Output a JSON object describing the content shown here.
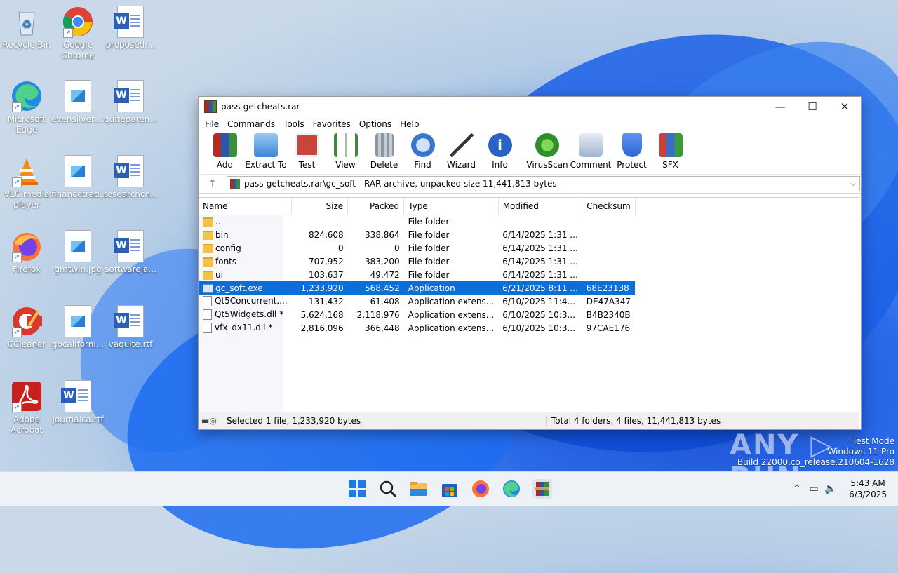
{
  "desktop": {
    "icons": [
      {
        "label": "Recycle Bin"
      },
      {
        "label": "Google Chrome"
      },
      {
        "label": "proposedr..."
      },
      {
        "label": "Microsoft Edge"
      },
      {
        "label": "evensilver...."
      },
      {
        "label": "quiteparen..."
      },
      {
        "label": "VLC media player"
      },
      {
        "label": "financetrad..."
      },
      {
        "label": "researchch..."
      },
      {
        "label": "Firefox"
      },
      {
        "label": "gmtwin.jpg"
      },
      {
        "label": "softwareja..."
      },
      {
        "label": "CCleaner"
      },
      {
        "label": "gocaliforni..."
      },
      {
        "label": "vaquite.rtf"
      },
      {
        "label": "Adobe Acrobat"
      },
      {
        "label": "journalca.rtf"
      }
    ]
  },
  "window": {
    "title": "pass-getcheats.rar",
    "controls": {
      "minimize": "—",
      "maximize": "☐",
      "close": "✕"
    },
    "menu": [
      "File",
      "Commands",
      "Tools",
      "Favorites",
      "Options",
      "Help"
    ],
    "toolbar": [
      {
        "label": "Add",
        "color": "#b62a21"
      },
      {
        "label": "Extract To",
        "color": "#3c86d8"
      },
      {
        "label": "Test",
        "color": "#c8453c"
      },
      {
        "label": "View",
        "color": "#3c8a3c"
      },
      {
        "label": "Delete",
        "color": "#8b96a3"
      },
      {
        "label": "Find",
        "color": "#3977cf"
      },
      {
        "label": "Wizard",
        "color": "#6aa3d9"
      },
      {
        "label": "Info",
        "color": "#2a63c4"
      },
      {
        "label": "VirusScan",
        "color": "#3aa832"
      },
      {
        "label": "Comment",
        "color": "#6f8fb5"
      },
      {
        "label": "Protect",
        "color": "#2e67d6"
      },
      {
        "label": "SFX",
        "color": "#c8413a"
      }
    ],
    "address": "pass-getcheats.rar\\gc_soft - RAR archive, unpacked size 11,441,813 bytes",
    "columns": {
      "name": "Name",
      "size": "Size",
      "packed": "Packed",
      "type": "Type",
      "modified": "Modified",
      "checksum": "Checksum"
    },
    "rows": [
      {
        "icon": "folder",
        "name": "..",
        "size": "",
        "packed": "",
        "type": "File folder",
        "modified": "",
        "checksum": ""
      },
      {
        "icon": "folder",
        "name": "bin",
        "size": "824,608",
        "packed": "338,864",
        "type": "File folder",
        "modified": "6/14/2025 1:31 ...",
        "checksum": ""
      },
      {
        "icon": "folder",
        "name": "config",
        "size": "0",
        "packed": "0",
        "type": "File folder",
        "modified": "6/14/2025 1:31 ...",
        "checksum": ""
      },
      {
        "icon": "folder",
        "name": "fonts",
        "size": "707,952",
        "packed": "383,200",
        "type": "File folder",
        "modified": "6/14/2025 1:31 ...",
        "checksum": ""
      },
      {
        "icon": "folder",
        "name": "ui",
        "size": "103,637",
        "packed": "49,472",
        "type": "File folder",
        "modified": "6/14/2025 1:31 ...",
        "checksum": ""
      },
      {
        "icon": "exe",
        "name": "gc_soft.exe",
        "size": "1,233,920",
        "packed": "568,452",
        "type": "Application",
        "modified": "6/21/2025 8:11 ...",
        "checksum": "68E23138",
        "selected": true
      },
      {
        "icon": "file",
        "name": "Qt5Concurrent....",
        "size": "131,432",
        "packed": "61,408",
        "type": "Application extens...",
        "modified": "6/10/2025 11:4...",
        "checksum": "DE47A347"
      },
      {
        "icon": "file",
        "name": "Qt5Widgets.dll *",
        "size": "5,624,168",
        "packed": "2,118,976",
        "type": "Application extens...",
        "modified": "6/10/2025 10:3...",
        "checksum": "B4B2340B"
      },
      {
        "icon": "file",
        "name": "vfx_dx11.dll *",
        "size": "2,816,096",
        "packed": "366,448",
        "type": "Application extens...",
        "modified": "6/10/2025 10:3...",
        "checksum": "97CAE176"
      }
    ],
    "status": {
      "left": "Selected 1 file, 1,233,920 bytes",
      "right": "Total 4 folders, 4 files, 11,441,813 bytes"
    }
  },
  "watermark": {
    "text": "ANY ▷ RUN",
    "line1": "Test Mode",
    "line2": "Windows 11 Pro",
    "line3": "Build 22000.co_release.210604-1628"
  },
  "taskbar": {
    "apps": [
      "start-icon",
      "search-icon",
      "file-explorer-icon",
      "store-icon",
      "firefox-icon",
      "edge-icon",
      "winrar-icon"
    ],
    "time": "5:43 AM",
    "date": "6/3/2025"
  }
}
